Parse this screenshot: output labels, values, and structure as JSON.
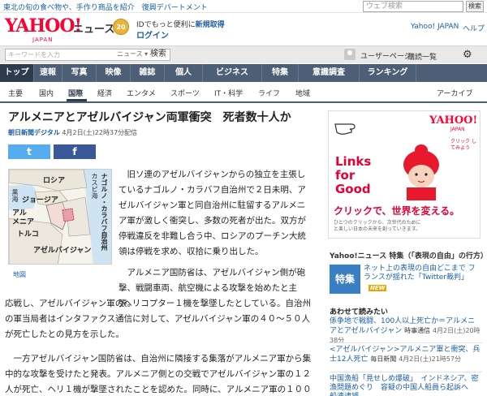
{
  "topstrip": {
    "promo": "東北の旬の食べ物や、手作り商品を紹介　復興デパートメント",
    "search_placeholder": "ウェブ検索",
    "search_button": "検索"
  },
  "header": {
    "logo": "YAHOO!",
    "logo_sub": "JAPAN",
    "service": "ニュース",
    "badge": "20",
    "id_prefix": "IDでもっと便利に",
    "id_link": "新規取得",
    "login": "ログイン",
    "yahoo_japan": "Yahoo! JAPAN",
    "help": "ヘルプ"
  },
  "searchbar": {
    "placeholder": "キーワードを入力",
    "select": "ニュース ▾",
    "button": "検索",
    "user_page": "ユーザーページ",
    "subscribe": "購読一覧"
  },
  "nav": {
    "items": [
      "トップ",
      "速報",
      "写真",
      "映像",
      "雑誌",
      "個人",
      "ビジネス",
      "特集",
      "意識調査",
      "ランキング"
    ]
  },
  "subnav": {
    "items": [
      "主要",
      "国内",
      "国際",
      "経済",
      "エンタメ",
      "スポーツ",
      "IT・科学",
      "ライフ",
      "地域"
    ],
    "right": "アーカイブ"
  },
  "article": {
    "title": "アルメニアとアゼルバイジャン両軍衝突　死者数十人か",
    "source": "朝日新聞デジタル",
    "date": "4月2日(土)22時37分配信",
    "twitter": "t",
    "facebook": "f",
    "map_labels": {
      "russia": "ロシア",
      "caspian": "カスピ海",
      "kurokai": "黒海",
      "georgia": "ジョージア",
      "armenia1": "アル",
      "armenia2": "メニア",
      "turkey": "トルコ",
      "azerbaijan": "アゼルバイジャン",
      "nagorno": "ナゴルノ・カラバフ自治州"
    },
    "map_link": "地図",
    "p1": "　旧ソ連のアゼルバイジャンからの独立を主張しているナゴルノ・カラバフ自治州で２日未明、アゼルバイジャン軍と同自治州に駐留するアルメニア軍が激しく衝突し、多数の死者が出た。双方が停戦違反を非難し合う中、ロシアのプーチン大統領は停戦を求め、収拾に乗り出した。",
    "p2a": "　アルメニア国防省は、アゼルバイジャン側が砲撃、戦闘車両、航空機による攻撃を始めたと主張。",
    "p2b": "応戦し、アゼルバイジャン軍のヘリコプター１機を撃墜したとしている。自治州の軍当局者はインタファクス通信に対して、アゼルバイジャン軍の４０～５０人が死亡したとの見方を示した。",
    "p3": "　一方アゼルバイジャン国防省は、自治州に隣接する集落がアルメニア軍から集中的な攻撃を受けたと発表。アルメニア側との交戦でアゼルバイジャン軍の１２人が死亡、ヘリ１機が撃墜されたことを認めた。同時に、アルメニア軍の１００人以上"
  },
  "ad": {
    "logo": "YAHOO!",
    "logo_sub": "JAPAN",
    "click_text": "クリック\nしてみよう",
    "links1": "Links",
    "links2": "for",
    "links3": "Good",
    "headline": "クリックで、世界を変える。",
    "sub1": "ひとつのクリックから、次世代のために",
    "sub2": "と楽しい日本の未来を創っていきます。"
  },
  "feature": {
    "title": "Yahoo!ニュース 特集（「表現の自由」の行方）",
    "badge": "特集",
    "text": "ネット上の表現の自由どこまで フランスが揺れた「Twitter裁判」",
    "new": "NEW"
  },
  "reads": {
    "title": "あわせて読みたい",
    "items": [
      {
        "link": "係争地で戦闘、100人以上死亡か＝アルメニアとアゼルバイジャン",
        "source": "時事通信",
        "time": "4月2日(土)20時38分"
      },
      {
        "link": "<アゼルバイジャン>アルメニア軍と衝突、兵士12人死亡",
        "source": "毎日新聞",
        "time": "4月2日(土)21時57分"
      },
      {
        "link": "中国漁船「見せしめ爆破」　インドネシア、密漁問題めぐり　容疑の中国人船員ら起訴へ　船速逮捕",
        "source": "",
        "time": ""
      }
    ]
  }
}
